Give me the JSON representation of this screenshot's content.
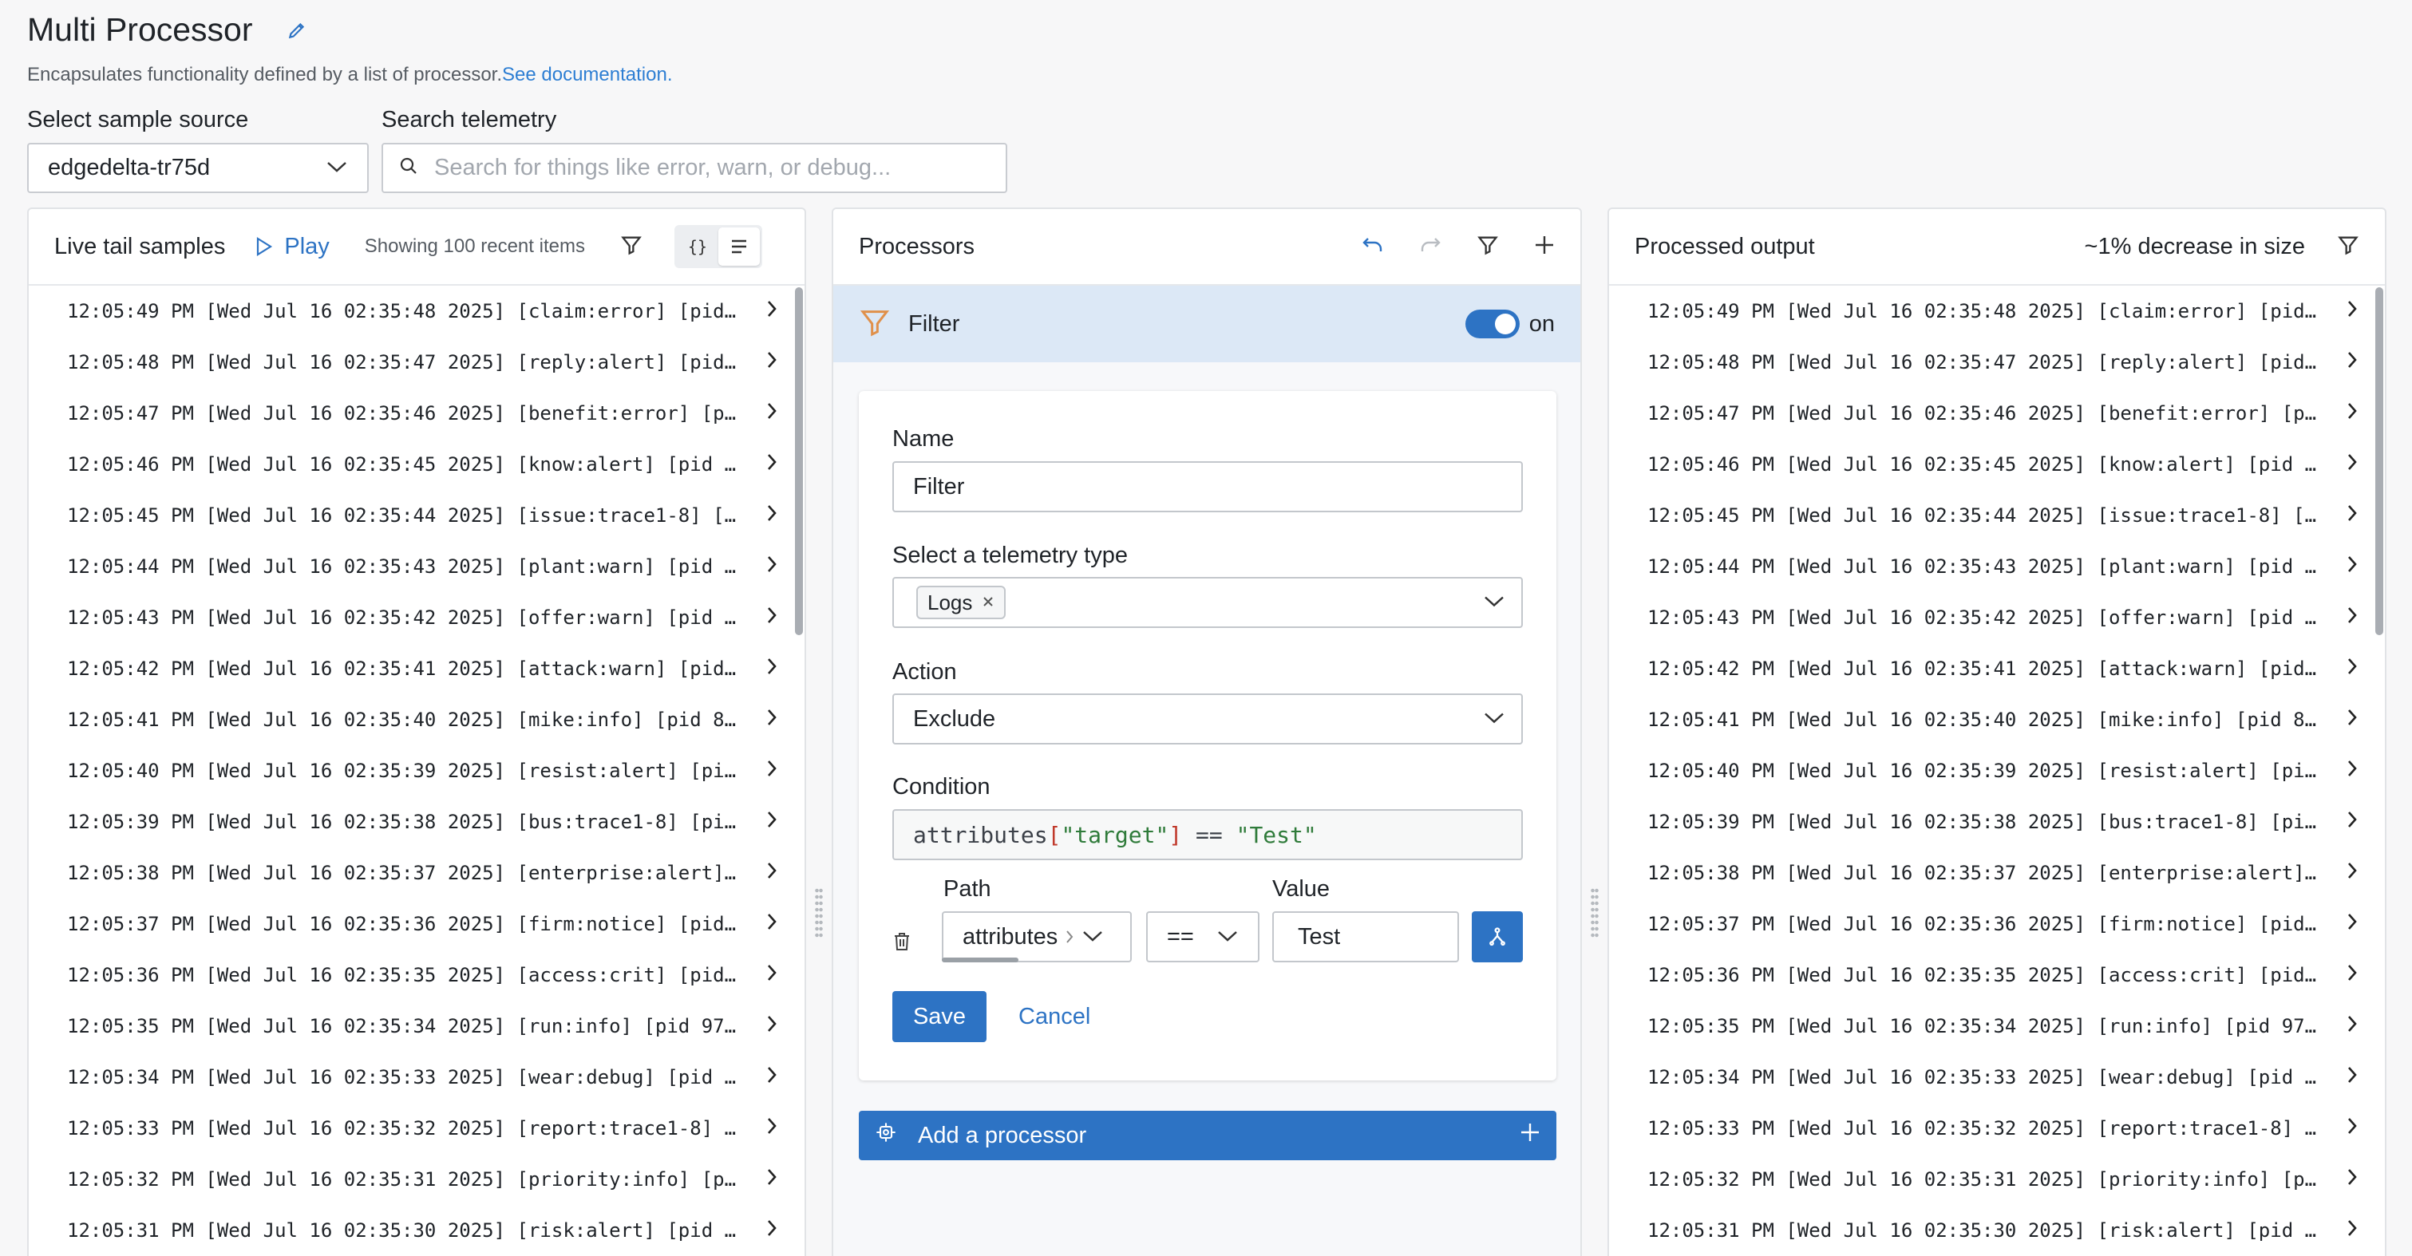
{
  "page": {
    "title": "Multi Processor",
    "description": "Encapsulates functionality defined by a list of processor.",
    "doc_link": "See documentation."
  },
  "source": {
    "label": "Select sample source",
    "value": "edgedelta-tr75d"
  },
  "search": {
    "label": "Search telemetry",
    "placeholder": "Search for things like error, warn, or debug..."
  },
  "live_tail": {
    "title": "Live tail samples",
    "play_label": "Play",
    "showing": "Showing 100 recent items",
    "rows": [
      "12:05:49 PM [Wed Jul 16 02:35:48 2025] [claim:error] [pid…",
      "12:05:48 PM [Wed Jul 16 02:35:47 2025] [reply:alert] [pid…",
      "12:05:47 PM [Wed Jul 16 02:35:46 2025] [benefit:error] [p…",
      "12:05:46 PM [Wed Jul 16 02:35:45 2025] [know:alert] [pid …",
      "12:05:45 PM [Wed Jul 16 02:35:44 2025] [issue:trace1-8] […",
      "12:05:44 PM [Wed Jul 16 02:35:43 2025] [plant:warn] [pid …",
      "12:05:43 PM [Wed Jul 16 02:35:42 2025] [offer:warn] [pid …",
      "12:05:42 PM [Wed Jul 16 02:35:41 2025] [attack:warn] [pid…",
      "12:05:41 PM [Wed Jul 16 02:35:40 2025] [mike:info] [pid 8…",
      "12:05:40 PM [Wed Jul 16 02:35:39 2025] [resist:alert] [pi…",
      "12:05:39 PM [Wed Jul 16 02:35:38 2025] [bus:trace1-8] [pi…",
      "12:05:38 PM [Wed Jul 16 02:35:37 2025] [enterprise:alert]…",
      "12:05:37 PM [Wed Jul 16 02:35:36 2025] [firm:notice] [pid…",
      "12:05:36 PM [Wed Jul 16 02:35:35 2025] [access:crit] [pid…",
      "12:05:35 PM [Wed Jul 16 02:35:34 2025] [run:info] [pid 97…",
      "12:05:34 PM [Wed Jul 16 02:35:33 2025] [wear:debug] [pid …",
      "12:05:33 PM [Wed Jul 16 02:35:32 2025] [report:trace1-8] …",
      "12:05:32 PM [Wed Jul 16 02:35:31 2025] [priority:info] [p…",
      "12:05:31 PM [Wed Jul 16 02:35:30 2025] [risk:alert] [pid …"
    ]
  },
  "processors": {
    "title": "Processors",
    "filter_label": "Filter",
    "toggle_label": "on",
    "form": {
      "name_label": "Name",
      "name_value": "Filter",
      "telemetry_label": "Select a telemetry type",
      "telemetry_chip": "Logs",
      "action_label": "Action",
      "action_value": "Exclude",
      "condition_label": "Condition",
      "condition": {
        "prefix": "attributes",
        "open": "[",
        "key": "\"target\"",
        "close": "]",
        "op": " == ",
        "value": "\"Test\""
      },
      "path_label": "Path",
      "path_value": "attributes",
      "operator_value": "==",
      "value_label": "Value",
      "value_value": "Test",
      "save_label": "Save",
      "cancel_label": "Cancel"
    },
    "add_label": "Add a processor"
  },
  "output": {
    "title": "Processed output",
    "decrease": "~1% decrease in size",
    "rows": [
      "12:05:49 PM [Wed Jul 16 02:35:48 2025] [claim:error] [pid…",
      "12:05:48 PM [Wed Jul 16 02:35:47 2025] [reply:alert] [pid…",
      "12:05:47 PM [Wed Jul 16 02:35:46 2025] [benefit:error] [p…",
      "12:05:46 PM [Wed Jul 16 02:35:45 2025] [know:alert] [pid …",
      "12:05:45 PM [Wed Jul 16 02:35:44 2025] [issue:trace1-8] […",
      "12:05:44 PM [Wed Jul 16 02:35:43 2025] [plant:warn] [pid …",
      "12:05:43 PM [Wed Jul 16 02:35:42 2025] [offer:warn] [pid …",
      "12:05:42 PM [Wed Jul 16 02:35:41 2025] [attack:warn] [pid…",
      "12:05:41 PM [Wed Jul 16 02:35:40 2025] [mike:info] [pid 8…",
      "12:05:40 PM [Wed Jul 16 02:35:39 2025] [resist:alert] [pi…",
      "12:05:39 PM [Wed Jul 16 02:35:38 2025] [bus:trace1-8] [pi…",
      "12:05:38 PM [Wed Jul 16 02:35:37 2025] [enterprise:alert]…",
      "12:05:37 PM [Wed Jul 16 02:35:36 2025] [firm:notice] [pid…",
      "12:05:36 PM [Wed Jul 16 02:35:35 2025] [access:crit] [pid…",
      "12:05:35 PM [Wed Jul 16 02:35:34 2025] [run:info] [pid 97…",
      "12:05:34 PM [Wed Jul 16 02:35:33 2025] [wear:debug] [pid …",
      "12:05:33 PM [Wed Jul 16 02:35:32 2025] [report:trace1-8] …",
      "12:05:32 PM [Wed Jul 16 02:35:31 2025] [priority:info] [p…",
      "12:05:31 PM [Wed Jul 16 02:35:30 2025] [risk:alert] [pid …"
    ]
  },
  "colors": {
    "accent": "#2d73c4",
    "link": "#2d7ed3",
    "filter_bar": "#dce8f6"
  },
  "icons": [
    "pencil-icon",
    "chevron-down-icon",
    "search-icon",
    "play-icon",
    "filter-icon",
    "code-view-icon",
    "list-view-icon",
    "chevron-right-icon",
    "undo-icon",
    "redo-icon",
    "plus-icon",
    "funnel-icon",
    "close-icon",
    "trash-icon",
    "branch-icon",
    "gear-icon"
  ]
}
